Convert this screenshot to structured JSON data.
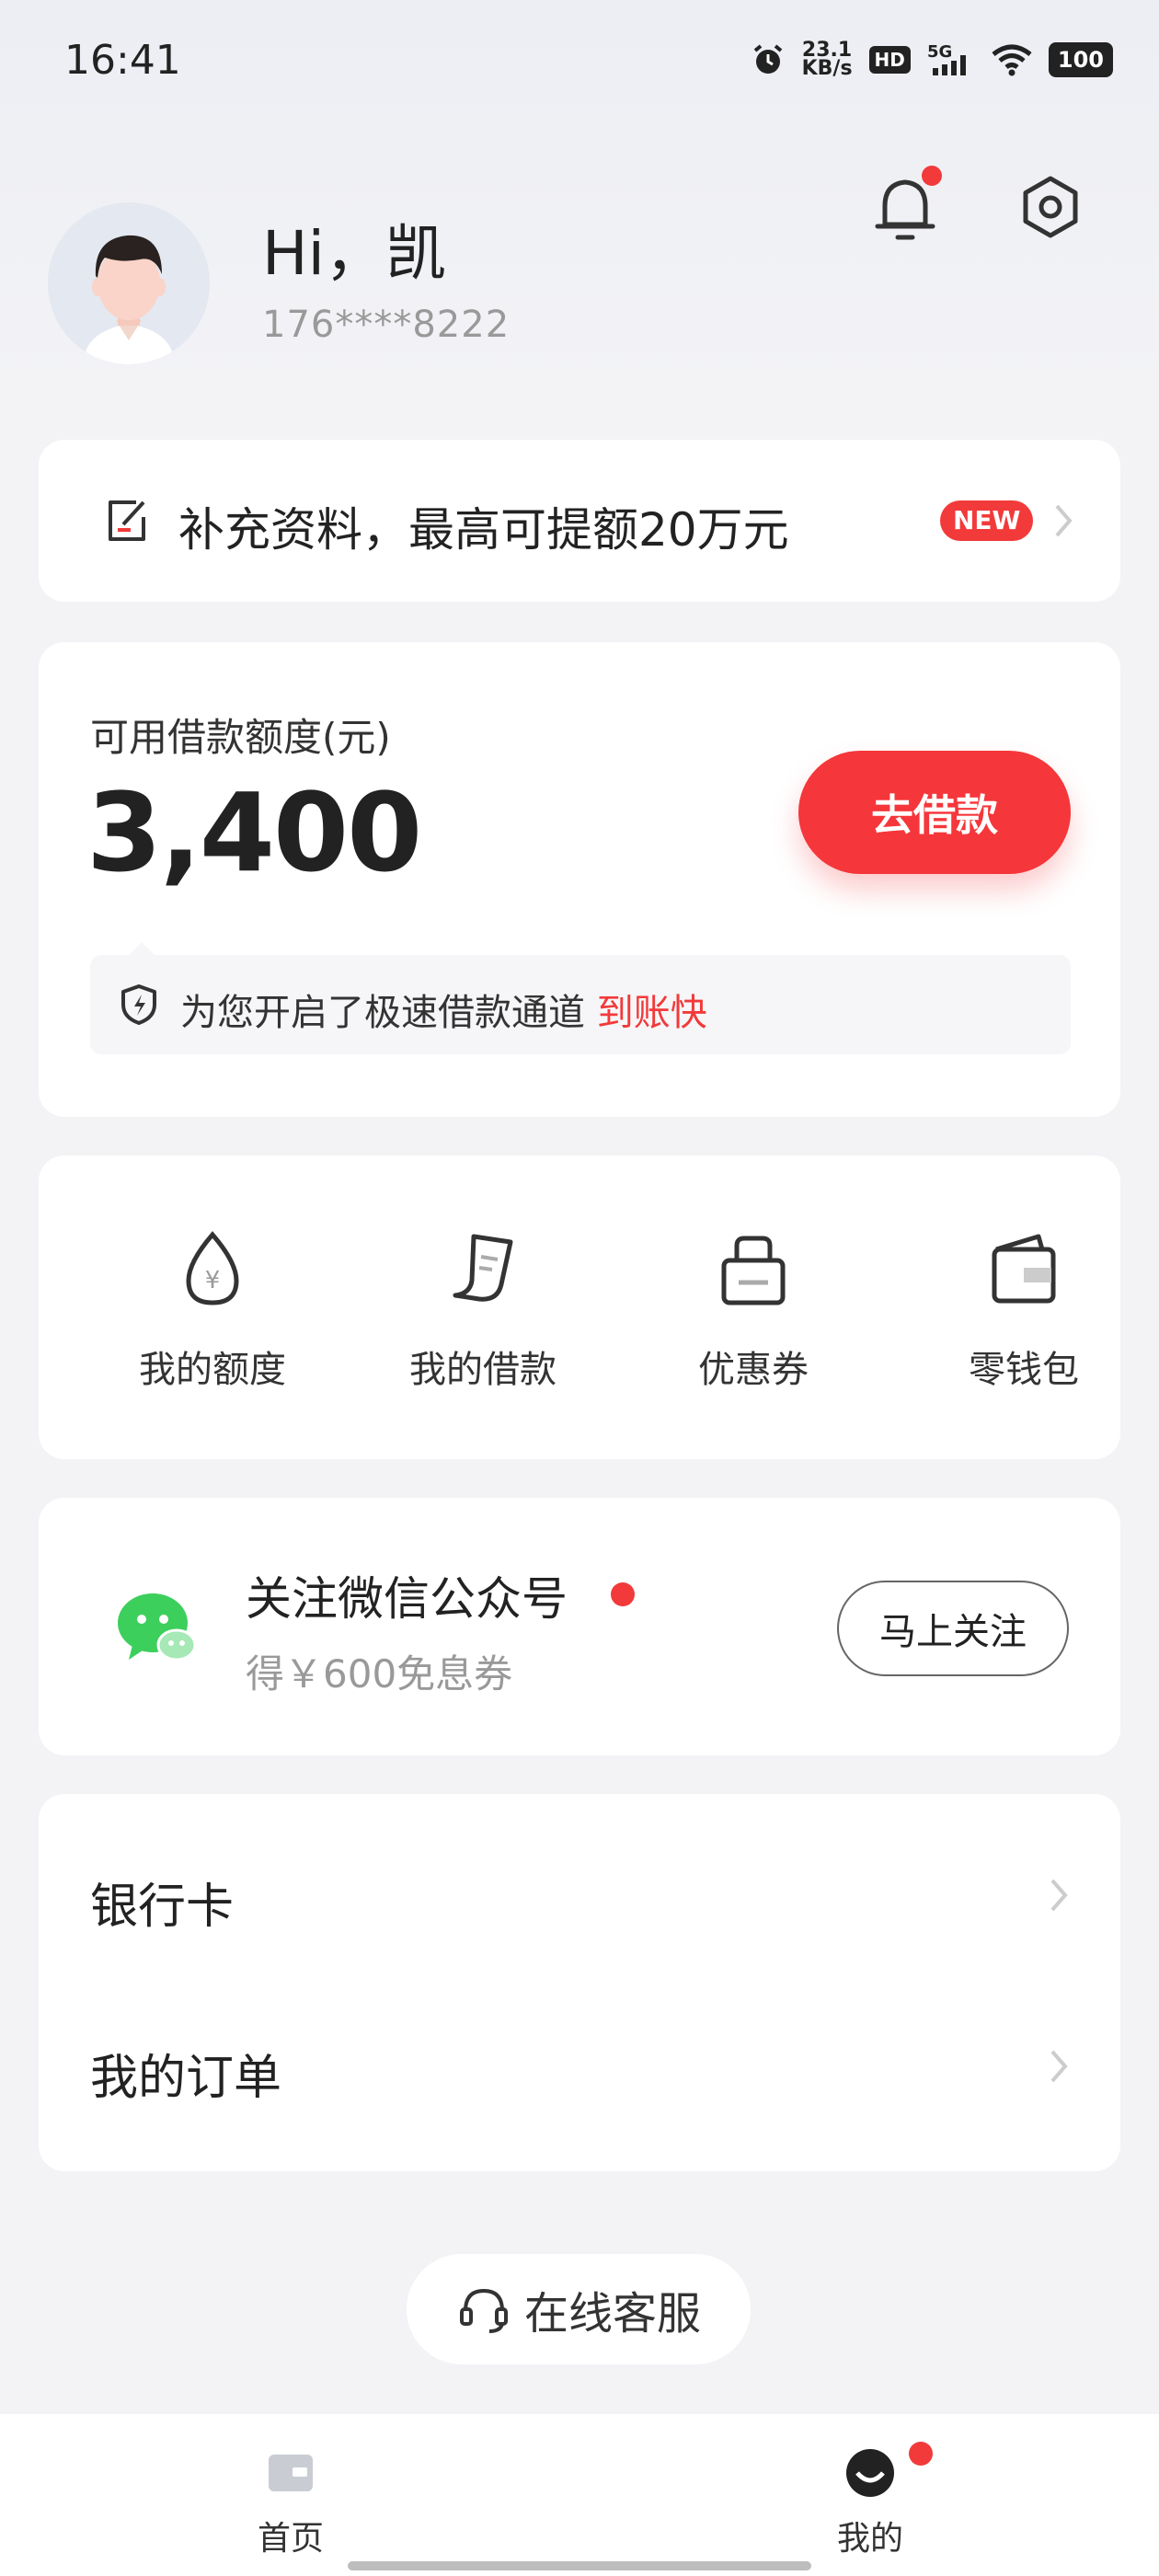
{
  "status_bar": {
    "time": "16:41",
    "speed_value": "23.1",
    "speed_unit": "KB/s",
    "hd": "HD",
    "network": "5G",
    "battery": "100"
  },
  "header": {
    "greeting": "Hi，凯",
    "phone": "176****8222"
  },
  "banner": {
    "text": "补充资料，最高可提额20万元",
    "badge": "NEW"
  },
  "loan": {
    "label": "可用借款额度(元)",
    "amount": "3,400",
    "button": "去借款",
    "fast_text": "为您开启了极速借款通道",
    "fast_highlight": "到账快"
  },
  "quick_actions": [
    {
      "label": "我的额度",
      "icon": "quota-drop-icon"
    },
    {
      "label": "我的借款",
      "icon": "loan-receipt-icon"
    },
    {
      "label": "优惠券",
      "icon": "coupon-bag-icon"
    },
    {
      "label": "零钱包",
      "icon": "wallet-icon"
    }
  ],
  "wechat": {
    "title": "关注微信公众号",
    "subtitle": "得￥600免息券",
    "button": "马上关注"
  },
  "menu": [
    {
      "label": "银行卡"
    },
    {
      "label": "我的订单"
    }
  ],
  "service": {
    "label": "在线客服"
  },
  "bottom_nav": [
    {
      "label": "首页"
    },
    {
      "label": "我的"
    }
  ],
  "colors": {
    "accent": "#f5363a",
    "wechat_green": "#3ccf5c",
    "text": "#222222",
    "muted": "#999999"
  }
}
